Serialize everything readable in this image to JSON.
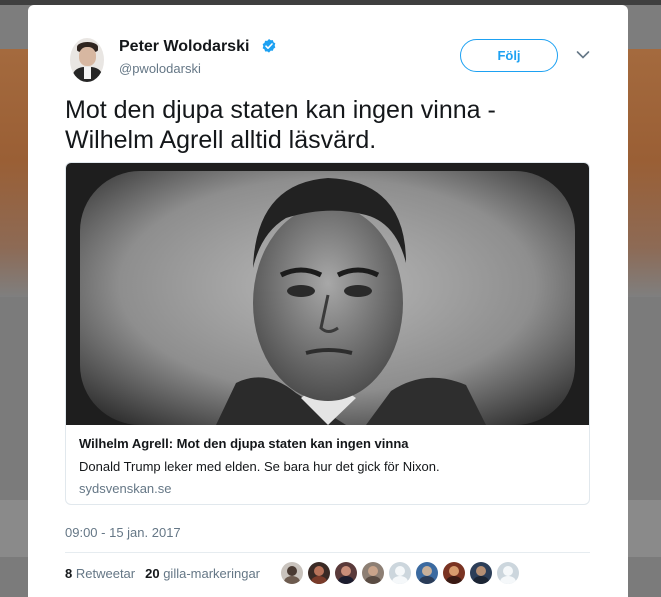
{
  "author": {
    "name": "Peter Wolodarski",
    "handle": "@pwolodarski",
    "verified": true,
    "follow_label": "Följ"
  },
  "tweet": {
    "text_line1": "Mot den djupa staten kan ingen vinna -",
    "text_line2": "Wilhelm Agrell alltid läsvärd.",
    "timestamp": "09:00 - 15 jan. 2017"
  },
  "card": {
    "title": "Wilhelm Agrell: Mot den djupa staten kan ingen vinna",
    "description": "Donald Trump leker med elden. Se bara hur det gick för Nixon.",
    "domain": "sydsvenskan.se"
  },
  "stats": {
    "retweets_count": "8",
    "retweets_label": "Retweetar",
    "likes_count": "20",
    "likes_label": "gilla-markeringar"
  },
  "likers": [
    {
      "icon": "liker-avatar",
      "bg": "#c9c3bd",
      "head": "#4a3b33",
      "body": "#6d5b4f"
    },
    {
      "icon": "liker-avatar",
      "bg": "#3a2a25",
      "head": "#b8735a",
      "body": "#7a3b2a"
    },
    {
      "icon": "liker-avatar",
      "bg": "#5a3a3a",
      "head": "#c98e7a",
      "body": "#1c1c2e"
    },
    {
      "icon": "liker-avatar",
      "bg": "#8d7f74",
      "head": "#c9a48b",
      "body": "#5a4c43"
    },
    {
      "icon": "default-avatar-icon",
      "bg": "#ccd6dd",
      "head": "#f5f8fa",
      "body": "#f5f8fa"
    },
    {
      "icon": "liker-avatar",
      "bg": "#3b6aa0",
      "head": "#c7b09a",
      "body": "#2a3c58"
    },
    {
      "icon": "liker-avatar",
      "bg": "#7a3322",
      "head": "#d89c6e",
      "body": "#3a1a14"
    },
    {
      "icon": "liker-avatar",
      "bg": "#2c3e58",
      "head": "#b58f74",
      "body": "#1b2433"
    },
    {
      "icon": "default-avatar-icon",
      "bg": "#ccd6dd",
      "head": "#f5f8fa",
      "body": "#f5f8fa"
    }
  ],
  "colors": {
    "accent": "#1da1f2",
    "text": "#14171a",
    "secondary": "#657786"
  }
}
